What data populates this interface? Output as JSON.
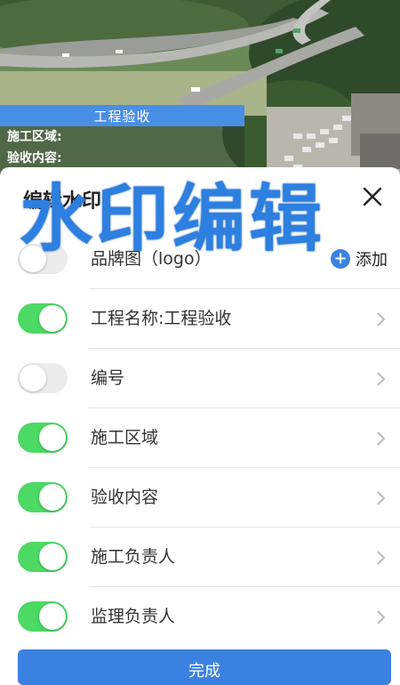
{
  "watermark": {
    "title": "工程验收",
    "area_label": "施工区域:",
    "content_label": "验收内容:"
  },
  "sheet": {
    "title": "编辑水印"
  },
  "banner": {
    "text": "水印编辑"
  },
  "logo_row": {
    "label": "品牌图（logo）",
    "add_label": "添加",
    "enabled": false
  },
  "items": [
    {
      "label": "工程名称:工程验收",
      "enabled": true
    },
    {
      "label": "编号",
      "enabled": false
    },
    {
      "label": "施工区域",
      "enabled": true
    },
    {
      "label": "验收内容",
      "enabled": true
    },
    {
      "label": "施工负责人",
      "enabled": true
    },
    {
      "label": "监理负责人",
      "enabled": true
    }
  ],
  "done_button": {
    "label": "完成"
  },
  "colors": {
    "accent": "#3b82e0",
    "toggle_on": "#4cd964",
    "toggle_off": "#ececec"
  }
}
